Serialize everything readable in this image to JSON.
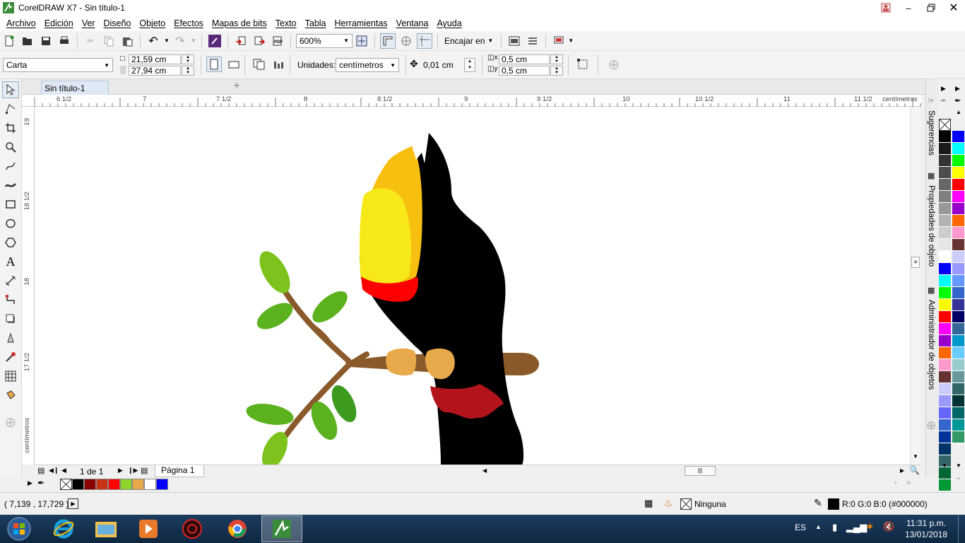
{
  "window": {
    "title": "CorelDRAW X7 - Sin título-1"
  },
  "menu": [
    "Archivo",
    "Edición",
    "Ver",
    "Diseño",
    "Objeto",
    "Efectos",
    "Mapas de bits",
    "Texto",
    "Tabla",
    "Herramientas",
    "Ventana",
    "Ayuda"
  ],
  "toolbar": {
    "zoom": "600%",
    "snap_label": "Encajar en"
  },
  "propbar": {
    "page_preset": "Carta",
    "width": "21,59 cm",
    "height": "27,94 cm",
    "units_label": "Unidades:",
    "units_value": "centímetros",
    "nudge": "0,01 cm",
    "dup_x": "0,5 cm",
    "dup_y": "0,5 cm"
  },
  "tabs": {
    "document": "Sin título-1"
  },
  "rulers": {
    "h_labels": [
      "6 1/2",
      "7",
      "7 1/2",
      "8",
      "8 1/2",
      "9",
      "9 1/2",
      "10",
      "10 1/2",
      "11",
      "11 1/2"
    ],
    "unit": "centímetros",
    "v_labels": [
      "19",
      "18 1/2",
      "18",
      "17 1/2"
    ]
  },
  "pagebar": {
    "page_count": "1 de 1",
    "page_tab": "Página 1"
  },
  "dockers": [
    "Sugerencias",
    "Propiedades de objeto",
    "Administrador de objetos"
  ],
  "status": {
    "coords": "( 7,139 , 17,729 )",
    "fill_none": "Ninguna",
    "color_readout": "R:0 G:0 B:0 (#000000)"
  },
  "taskbar": {
    "lang": "ES",
    "time": "11:31 p.m.",
    "date": "13/01/2018"
  },
  "doc_palette_colors": [
    "#000000",
    "#8b0000",
    "#c83214",
    "#ff0000",
    "#8fd42a",
    "#e8a94a",
    "#ffffff",
    "#0000ff"
  ],
  "palette_col1": [
    "#000000",
    "#1a1a1a",
    "#333333",
    "#4d4d4d",
    "#666666",
    "#808080",
    "#999999",
    "#b3b3b3",
    "#cccccc",
    "#e6e6e6",
    "#ffffff",
    "#0000ff",
    "#00ffff",
    "#00ff00",
    "#ffff00",
    "#ff0000",
    "#ff00ff",
    "#9900cc",
    "#ff6600",
    "#ff99cc",
    "#663333",
    "#ccccff",
    "#9999ff",
    "#6666ff",
    "#3366cc",
    "#003399",
    "#003366",
    "#336666",
    "#006633",
    "#009933"
  ],
  "palette_col2": [
    "#0000ff",
    "#00ffff",
    "#00ff00",
    "#ffff00",
    "#ff0000",
    "#ff00ff",
    "#9900cc",
    "#ff6600",
    "#ff99cc",
    "#663333",
    "#ccccff",
    "#9999ff",
    "#6699ff",
    "#3366cc",
    "#333399",
    "#000066",
    "#336699",
    "#0099cc",
    "#66ccff",
    "#99cccc",
    "#669999",
    "#336666",
    "#003333",
    "#006666",
    "#009999",
    "#339966"
  ]
}
